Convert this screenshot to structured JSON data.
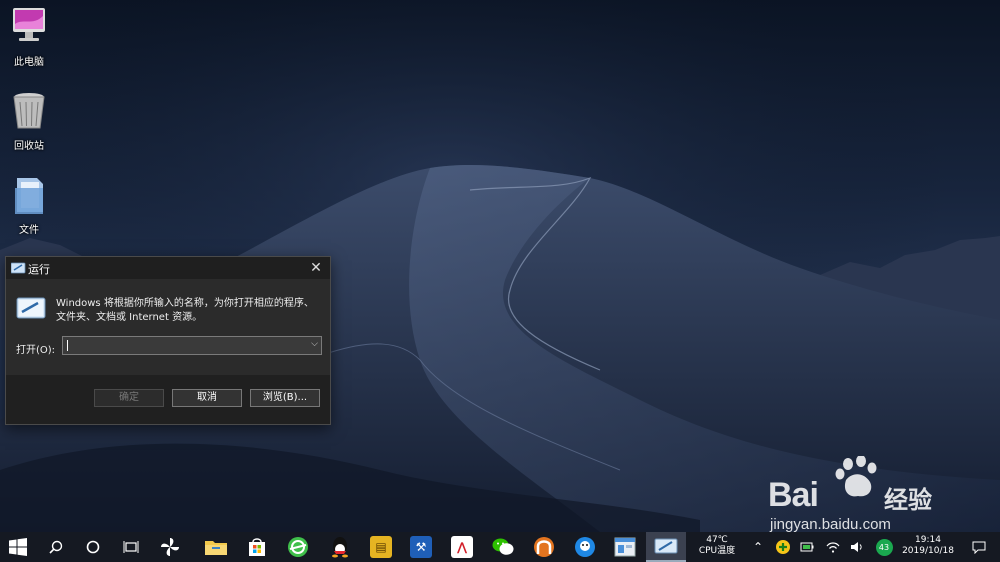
{
  "desktop": {
    "icons": [
      {
        "label": "此电脑",
        "icon": "computer-icon"
      },
      {
        "label": "回收站",
        "icon": "recycle-bin-icon"
      },
      {
        "label": "文件",
        "icon": "folder-icon"
      }
    ]
  },
  "run_dialog": {
    "title": "运行",
    "close_glyph": "✕",
    "description": "Windows 将根据你所输入的名称，为你打开相应的程序、文件夹、文档或 Internet 资源。",
    "open_label": "打开(O):",
    "open_value": "",
    "dropdown_glyph": "⌵",
    "buttons": {
      "ok": "确定",
      "cancel": "取消",
      "browse": "浏览(B)..."
    }
  },
  "taskbar": {
    "start_icon": "windows-start-icon",
    "search_icon": "search-icon",
    "cortana_icon": "cortana-ring-icon",
    "task_view_icon": "task-view-icon",
    "apps": [
      "pinwheel-app-icon",
      "file-explorer-icon",
      "store-icon",
      "browser-icon",
      "qq-icon",
      "app-icon",
      "app-icon",
      "app-icon",
      "wechat-icon",
      "app-icon",
      "app-icon",
      "app-icon",
      "run-dialog-icon"
    ],
    "cpu_temp": "47℃",
    "cpu_label": "CPU温度",
    "tray_badge": "43",
    "time": "19:14",
    "date": "2019/10/18"
  },
  "watermark": {
    "brand": "Bai",
    "brand_suffix": "经验",
    "url": "jingyan.baidu.com"
  },
  "colors": {
    "taskbar": "#151922",
    "dialog_body": "#2b2b2b",
    "dialog_footer": "#202020",
    "accent_green": "#1aa84f"
  }
}
